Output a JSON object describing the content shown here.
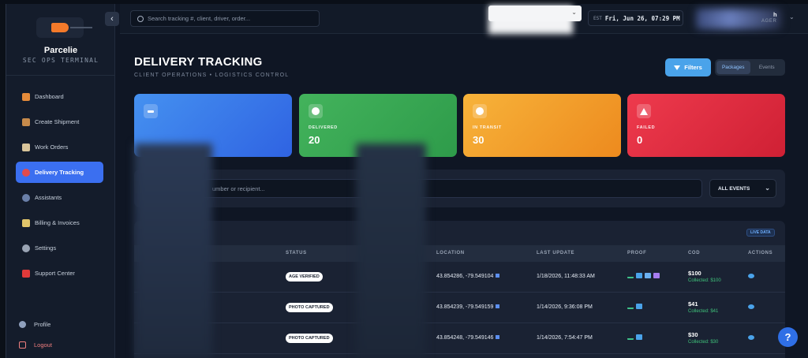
{
  "brand": {
    "name": "Parcelie",
    "subtitle": "SEC OPS TERMINAL"
  },
  "sidebar": {
    "items": [
      {
        "label": "Dashboard",
        "icon": "bar-chart-icon",
        "color": "#e58b3a"
      },
      {
        "label": "Create Shipment",
        "icon": "package-icon",
        "color": "#c68a4b"
      },
      {
        "label": "Work Orders",
        "icon": "clipboard-icon",
        "color": "#d8c49a"
      },
      {
        "label": "Delivery Tracking",
        "icon": "pin-icon",
        "color": "#e34b4b",
        "active": true
      },
      {
        "label": "Assistants",
        "icon": "people-icon",
        "color": "#6a7fa8"
      },
      {
        "label": "Billing & Invoices",
        "icon": "credit-card-icon",
        "color": "#e0c46a"
      },
      {
        "label": "Settings",
        "icon": "gear-icon",
        "color": "#9aa4b4"
      },
      {
        "label": "Support Center",
        "icon": "sos-icon",
        "color": "#e03a3a"
      }
    ],
    "bottom": {
      "profile": "Profile",
      "logout": "Logout"
    }
  },
  "topbar": {
    "search_placeholder": "Search tracking #, client, driver, order...",
    "tz": "EST",
    "datetime": "Fri, Jun 26, 07:29 PM",
    "user_name_suffix": "h",
    "user_role_suffix": "AGER"
  },
  "header": {
    "title": "DELIVERY TRACKING",
    "subtitle": "CLIENT OPERATIONS • LOGISTICS CONTROL",
    "filters_label": "Filters",
    "tabs": [
      "Packages",
      "Events"
    ]
  },
  "stats": [
    {
      "label": "",
      "value": "",
      "color": "#3b7ae9"
    },
    {
      "label": "DELIVERED",
      "value": "20",
      "color": "#3aa957"
    },
    {
      "label": "IN TRANSIT",
      "value": "30",
      "color": "#f29f2c"
    },
    {
      "label": "FAILED",
      "value": "0",
      "color": "#e02c40"
    }
  ],
  "filter_bar": {
    "search_placeholder": "umber or recipient...",
    "events_select": "ALL EVENTS"
  },
  "table": {
    "badge": "LIVE DATA",
    "headers": [
      "STATUS",
      "LOCATION",
      "LAST UPDATE",
      "PROOF",
      "COD",
      "ACTIONS"
    ],
    "rows": [
      {
        "status": "AGE VERIFIED",
        "location": "43.854286, -79.549104",
        "updated": "1/18/2026, 11:48:33 AM",
        "proof": [
          "signature-icon",
          "camera-icon",
          "id-icon",
          "card-icon"
        ],
        "cod": "$100",
        "collected": "Collected: $100"
      },
      {
        "status": "PHOTO CAPTURED",
        "location": "43.854239, -79.549159",
        "updated": "1/14/2026, 9:36:08 PM",
        "proof": [
          "signature-icon",
          "camera-icon"
        ],
        "cod": "$41",
        "collected": "Collected: $41"
      },
      {
        "status": "PHOTO CAPTURED",
        "location": "43.854248, -79.549146",
        "updated": "1/14/2026, 7:54:47 PM",
        "proof": [
          "signature-icon",
          "camera-icon"
        ],
        "cod": "$30",
        "collected": "Collected: $30"
      }
    ]
  },
  "help_label": "?"
}
